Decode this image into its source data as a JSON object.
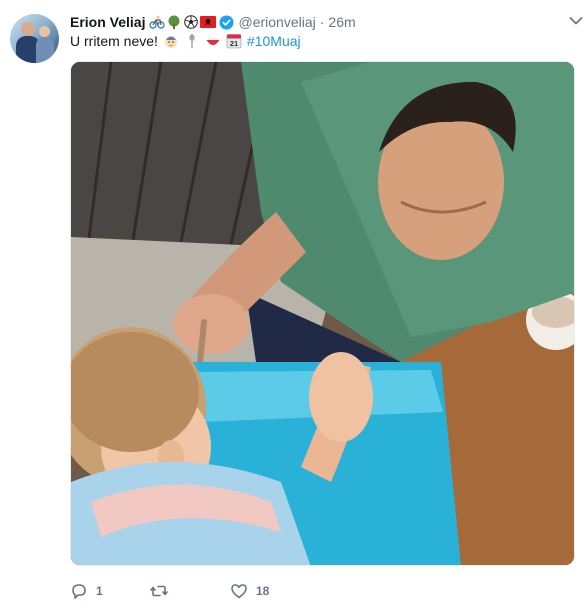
{
  "tweet": {
    "author_name": "Erion Veliaj",
    "author_handle": "@erionveliaj",
    "separator": "·",
    "time": "26m",
    "name_emojis": [
      "bicycle-icon",
      "tree-icon",
      "soccer-ball-icon",
      "albania-flag-icon"
    ],
    "text": "U rritem neve!",
    "text_emojis": [
      "baby-face-icon",
      "spoon-icon",
      "bowl-icon",
      "calendar-icon"
    ],
    "calendar_day": "21",
    "hashtag": "#10Muaj",
    "verified": true
  },
  "actions": {
    "reply_count": "1",
    "retweet_count": "",
    "like_count": "18"
  },
  "colors": {
    "link": "#1b95e0",
    "muted": "#657786",
    "verified_badge": "#1da1f2"
  }
}
